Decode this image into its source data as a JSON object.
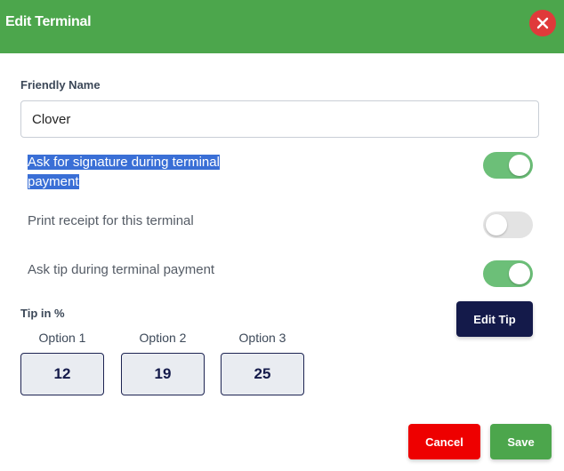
{
  "dialog": {
    "title": "Edit Terminal",
    "header_color": "#4ca64c",
    "close_icon": "close-icon"
  },
  "friendly_name": {
    "label": "Friendly Name",
    "value": "Clover"
  },
  "settings": [
    {
      "label_line1": "Ask for signature during terminal",
      "label_line2": "payment",
      "enabled": true
    },
    {
      "label": "Print receipt for this terminal",
      "enabled": false
    },
    {
      "label": "Ask tip during terminal payment",
      "enabled": true
    }
  ],
  "tip": {
    "title": "Tip in %",
    "edit_button": "Edit Tip",
    "options": [
      {
        "label": "Option 1",
        "value": "12"
      },
      {
        "label": "Option 2",
        "value": "19"
      },
      {
        "label": "Option 3",
        "value": "25"
      }
    ]
  },
  "footer": {
    "cancel_label": "Cancel",
    "save_label": "Save"
  },
  "colors": {
    "accent_green": "#4ca64c",
    "toggle_on": "#6cbf78",
    "toggle_off": "#e3e3e3",
    "dark_navy": "#141a4a",
    "danger_red": "#ee0000",
    "selection_blue": "#3a6fd6"
  }
}
